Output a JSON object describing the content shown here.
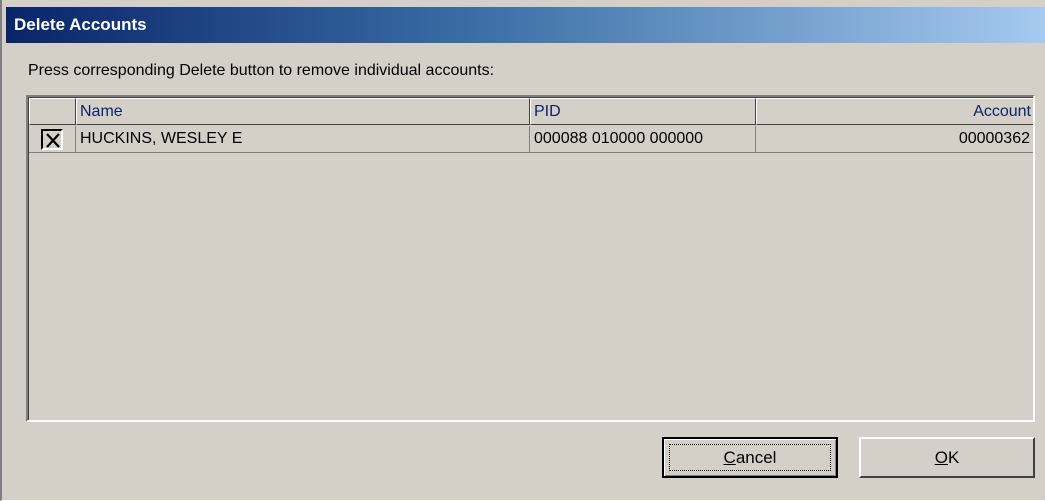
{
  "window": {
    "title": "Delete Accounts"
  },
  "instructions": "Press corresponding Delete button to remove individual accounts:",
  "grid": {
    "columns": [
      "Name",
      "PID",
      "Account"
    ],
    "rows": [
      {
        "delete_icon": "x-icon",
        "name": "HUCKINS, WESLEY E",
        "pid": "000088 010000 000000",
        "account": "00000362"
      }
    ]
  },
  "buttons": {
    "cancel": {
      "mnemonic": "C",
      "rest": "ancel"
    },
    "ok": {
      "mnemonic": "O",
      "rest": "K"
    }
  }
}
